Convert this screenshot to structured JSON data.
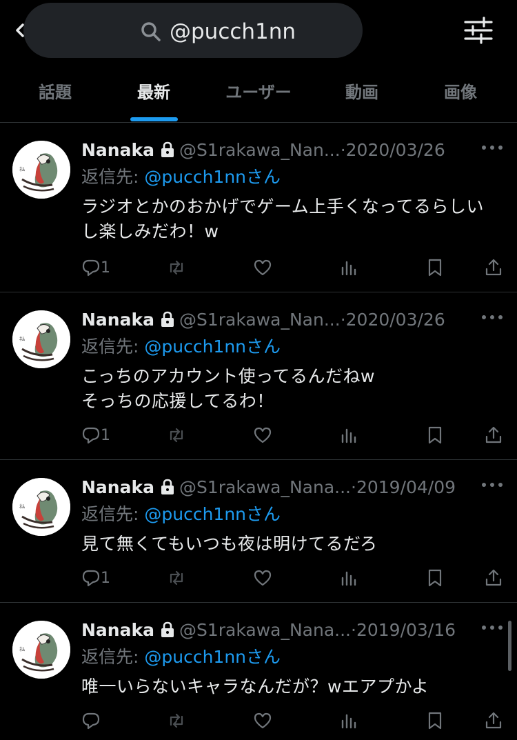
{
  "search": {
    "query": "@pucch1nn"
  },
  "tabs": [
    {
      "label": "話題",
      "active": false
    },
    {
      "label": "最新",
      "active": true
    },
    {
      "label": "ユーザー",
      "active": false
    },
    {
      "label": "動画",
      "active": false
    },
    {
      "label": "画像",
      "active": false
    }
  ],
  "tweets": [
    {
      "name": "Nanaka",
      "handle": "@S1rakawa_Nan...",
      "date": "2020/03/26",
      "reply_prefix": "返信先: ",
      "reply_to": "@pucch1nnさん",
      "lines": [
        "ラジオとかのおかげでゲーム上手くなってるらしい",
        "し楽しみだわ！w"
      ],
      "reply_count": "1"
    },
    {
      "name": "Nanaka",
      "handle": "@S1rakawa_Nan...",
      "date": "2020/03/26",
      "reply_prefix": "返信先: ",
      "reply_to": "@pucch1nnさん",
      "lines": [
        "こっちのアカウント使ってるんだねw",
        "そっちの応援してるわ！"
      ],
      "reply_count": "1"
    },
    {
      "name": "Nanaka",
      "handle": "@S1rakawa_Nana...",
      "date": "2019/04/09",
      "reply_prefix": "返信先: ",
      "reply_to": "@pucch1nnさん",
      "lines": [
        "見て無くてもいつも夜は明けてるだろ"
      ],
      "reply_count": "1"
    },
    {
      "name": "Nanaka",
      "handle": "@S1rakawa_Nana...",
      "date": "2019/03/16",
      "reply_prefix": "返信先: ",
      "reply_to": "@pucch1nnさん",
      "lines": [
        "唯一いらないキャラなんだが？wエアプかよ"
      ],
      "reply_count": ""
    }
  ],
  "separator_dot": "·",
  "icons": [
    "back-icon",
    "search-icon",
    "filter-icon",
    "lock-icon",
    "more-icon",
    "reply-icon",
    "retweet-icon",
    "like-icon",
    "views-icon",
    "bookmark-icon",
    "share-icon"
  ],
  "colors": {
    "background": "#000000",
    "accent": "#1d9bf0",
    "muted": "#71767b",
    "text": "#e7e9ea"
  }
}
